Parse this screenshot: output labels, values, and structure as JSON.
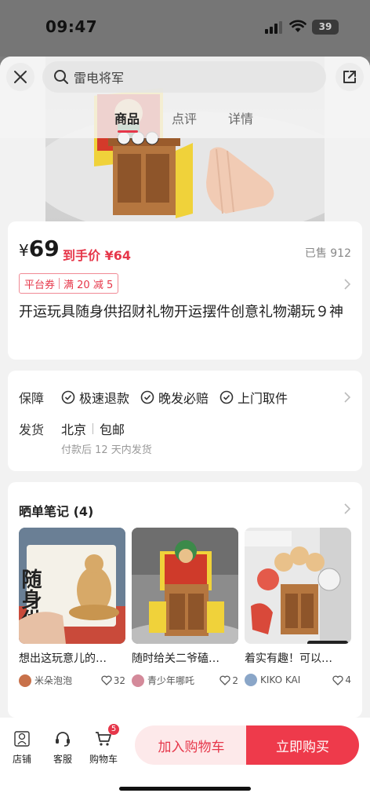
{
  "status_bar": {
    "time": "09:47",
    "battery": "39"
  },
  "top": {
    "search_text": "雷电将军",
    "tabs": [
      {
        "label": "商品",
        "active": true
      },
      {
        "label": "点评",
        "active": false
      },
      {
        "label": "详情",
        "active": false
      }
    ]
  },
  "product": {
    "currency": "¥",
    "price": "69",
    "final_price": "到手价 ¥64",
    "sold": "已售 912",
    "coupon_type": "平台券",
    "coupon_rule": "满 20 减 5",
    "title": "开运玩具随身供招财礼物开运摆件创意礼物潮玩９神"
  },
  "service": {
    "guarantee_label": "保障",
    "guarantees": [
      "极速退款",
      "晚发必赔",
      "上门取件"
    ],
    "shipping_label": "发货",
    "ship_from": "北京",
    "shipping_fee": "包邮",
    "ship_note": "付款后 12 天内发货"
  },
  "notes": {
    "title": "晒单笔记 (4)",
    "items": [
      {
        "text": "想出这玩意儿的…",
        "user": "米朵泡泡",
        "likes": "32",
        "image_text": "随身供",
        "avatar_color": "#c8714a"
      },
      {
        "text": "随时给关二爷磕…",
        "user": "青少年哪吒",
        "likes": "2",
        "avatar_color": "#d48a9a"
      },
      {
        "text": "着实有趣！可以…",
        "user": "KIKO KAI",
        "likes": "4",
        "avatar_color": "#8aa6c8"
      }
    ]
  },
  "bottom_bar": {
    "shop": "店铺",
    "service": "客服",
    "cart": "购物车",
    "cart_count": "5",
    "add_to_cart": "加入购物车",
    "buy_now": "立即购买"
  },
  "colors": {
    "accent": "#e6374a",
    "background": "#f2f2f2"
  }
}
